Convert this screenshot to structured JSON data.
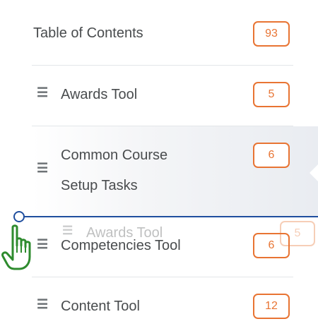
{
  "toc": {
    "label": "Table of Contents",
    "count": "93"
  },
  "items": [
    {
      "label": "Awards Tool",
      "count": "5"
    },
    {
      "label_line1": "Common Course",
      "label_line2": "Setup Tasks",
      "count": "6"
    },
    {
      "label": "Competencies Tool",
      "count": "6"
    },
    {
      "label": "Content Tool",
      "count": "12"
    }
  ],
  "drag_ghost": {
    "label": "Awards Tool",
    "count": "5"
  },
  "handle_glyph": "☰",
  "colors": {
    "badge": "#e87433",
    "drop_line": "#1f4e9e",
    "cursor": "#2e8b2e"
  },
  "icons": {
    "drag_handle": "drag-handle-icon",
    "cursor": "hand-pointer-icon"
  }
}
